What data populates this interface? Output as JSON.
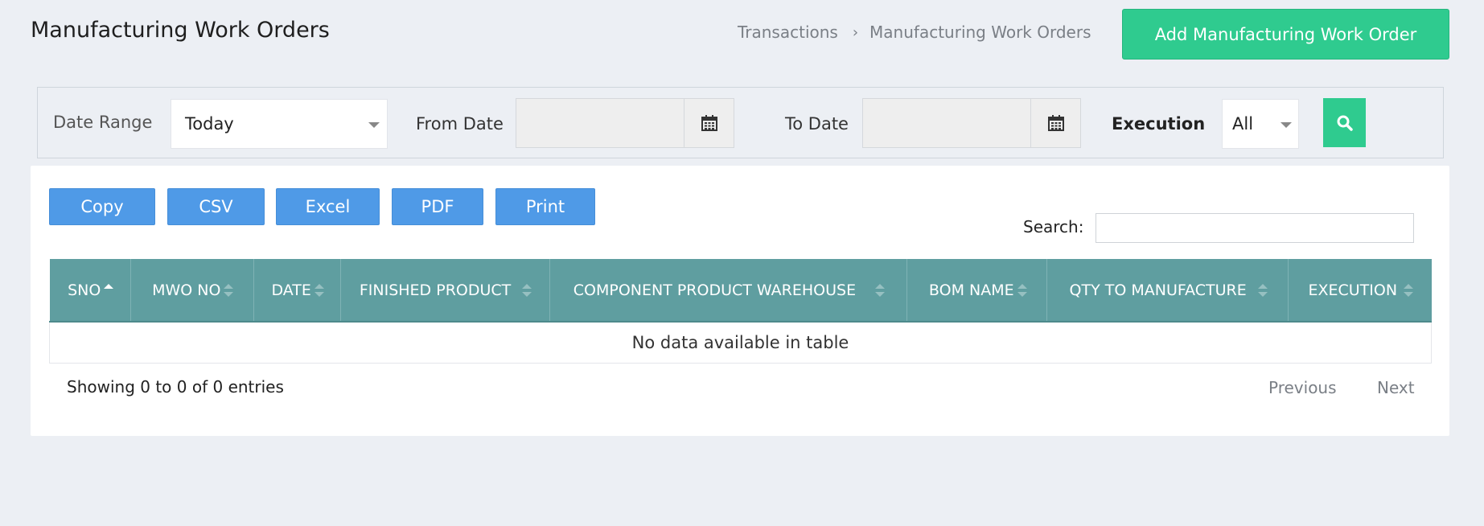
{
  "header": {
    "title": "Manufacturing Work Orders",
    "breadcrumb": [
      "Transactions",
      "Manufacturing Work Orders"
    ],
    "breadcrumb_separator": "›",
    "add_button": "Add Manufacturing Work Order"
  },
  "filters": {
    "date_range_label": "Date Range",
    "date_range_value": "Today",
    "from_date_label": "From Date",
    "from_date_value": "",
    "to_date_label": "To Date",
    "to_date_value": "",
    "execution_label": "Execution",
    "execution_value": "All",
    "search_icon": "search-icon",
    "calendar_icon": "calendar-icon"
  },
  "toolbar": {
    "buttons": [
      "Copy",
      "CSV",
      "Excel",
      "PDF",
      "Print"
    ],
    "search_label": "Search:",
    "search_value": ""
  },
  "table": {
    "columns": [
      "SNO",
      "MWO NO",
      "DATE",
      "FINISHED PRODUCT",
      "COMPONENT PRODUCT WAREHOUSE",
      "BOM NAME",
      "QTY TO MANUFACTURE",
      "EXECUTION"
    ],
    "sorted_column": "SNO",
    "sort_direction": "asc",
    "empty_message": "No data available in table"
  },
  "footer": {
    "info": "Showing 0 to 0 of 0 entries",
    "previous": "Previous",
    "next": "Next"
  },
  "colors": {
    "background": "#eceff4",
    "accent_green": "#2fcb8f",
    "export_blue": "#4f9ae7",
    "table_header": "#5f9ea0"
  }
}
